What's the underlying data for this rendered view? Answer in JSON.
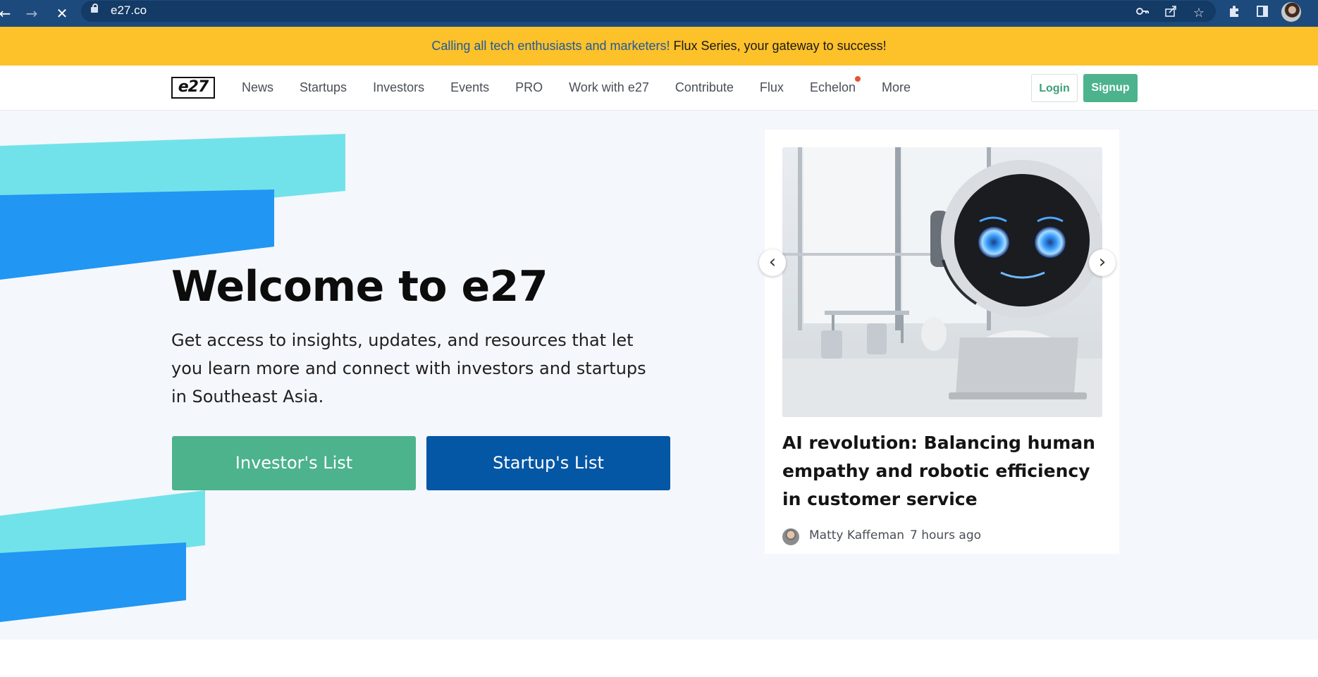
{
  "browser": {
    "url": "e27.co",
    "back_icon": "←",
    "forward_icon": "→",
    "stop_icon": "✕",
    "toolbar_icons": [
      "key-icon",
      "share-icon",
      "star-icon",
      "extensions-icon",
      "sidepanel-icon"
    ]
  },
  "banner": {
    "link_text": "Calling all tech enthusiasts and marketers!",
    "text": " Flux Series, your gateway to success!"
  },
  "header": {
    "logo": "e27",
    "nav": [
      "News",
      "Startups",
      "Investors",
      "Events",
      "PRO",
      "Work with e27",
      "Contribute",
      "Flux",
      "Echelon",
      "More"
    ],
    "login": "Login",
    "signup": "Signup"
  },
  "hero": {
    "title": "Welcome to e27",
    "description": "Get access to insights, updates, and resources that let you learn more and connect with investors and startups in Southeast Asia.",
    "investor_button": "Investor's List",
    "startup_button": "Startup's List"
  },
  "article": {
    "title": "AI revolution: Balancing human empathy and robotic efficiency in customer service",
    "author": "Matty Kaffeman",
    "time": "7 hours ago",
    "prev_icon": "‹",
    "next_icon": "›"
  },
  "colors": {
    "browser_bar": "#1d4a7c",
    "banner": "#fdc12a",
    "accent_green": "#4cb38d",
    "accent_blue": "#0457a5",
    "shape_cyan": "#72e2ea",
    "shape_blue": "#2196f3"
  }
}
